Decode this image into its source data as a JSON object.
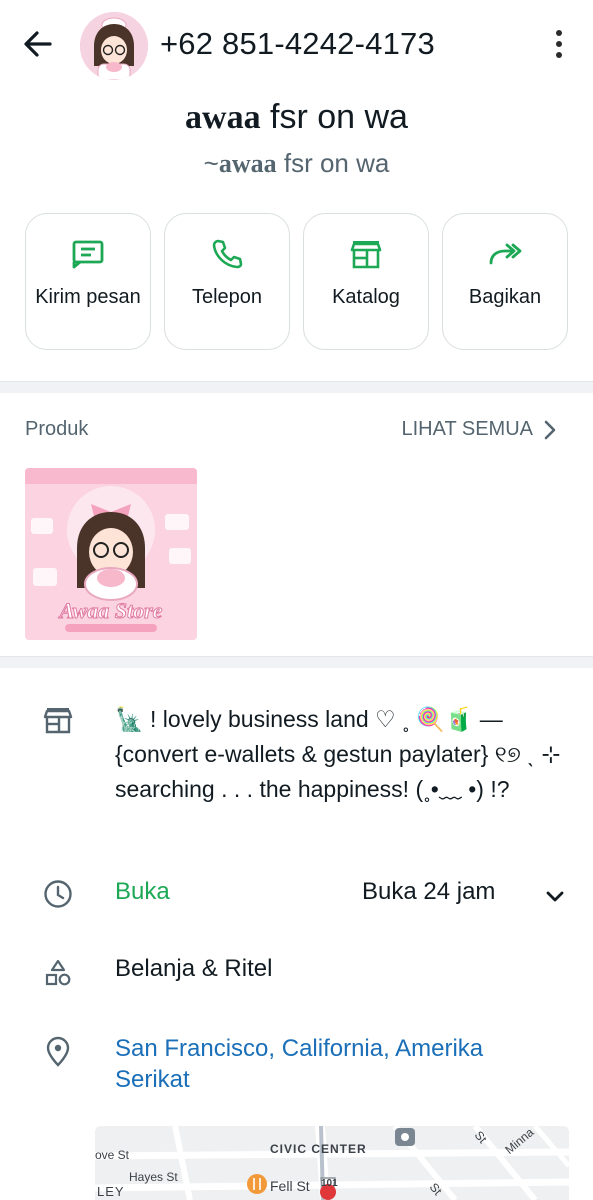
{
  "header": {
    "phone": "+62 851-4242-4173"
  },
  "profile": {
    "name_bold": "awaa",
    "name_rest": " fsr on wa",
    "subname_prefix": "~",
    "subname_bold": "awaa",
    "subname_rest": " fsr on wa"
  },
  "actions": [
    {
      "label": "Kirim pesan",
      "icon": "message-icon"
    },
    {
      "label": "Telepon",
      "icon": "phone-icon"
    },
    {
      "label": "Katalog",
      "icon": "storefront-icon"
    },
    {
      "label": "Bagikan",
      "icon": "forward-icon"
    }
  ],
  "products": {
    "heading": "Produk",
    "see_all": "LIHAT SEMUA",
    "item_image_text": "Awaa Store"
  },
  "business": {
    "description": "🗽 ! lovely business land ♡ ˳ 🍭🧃 — {convert e-wallets & gestun paylater} ୧୭ ˎ ⊹ searching . . . the happiness! (˳•﹏ •) !?",
    "open_status": "Buka",
    "open_hours": "Buka 24 jam",
    "category": "Belanja & Ritel",
    "location": "San Francisco, California, Amerika Serikat"
  },
  "map": {
    "labels": [
      "ove St",
      "Hayes St",
      "CIVIC CENTER",
      "Fell St",
      "LEY",
      "101",
      "Minna",
      "St",
      "St"
    ]
  },
  "colors": {
    "accent_green": "#1da855",
    "link_blue": "#1a6fb8",
    "text_primary": "#111b21",
    "text_secondary": "#54656f"
  }
}
